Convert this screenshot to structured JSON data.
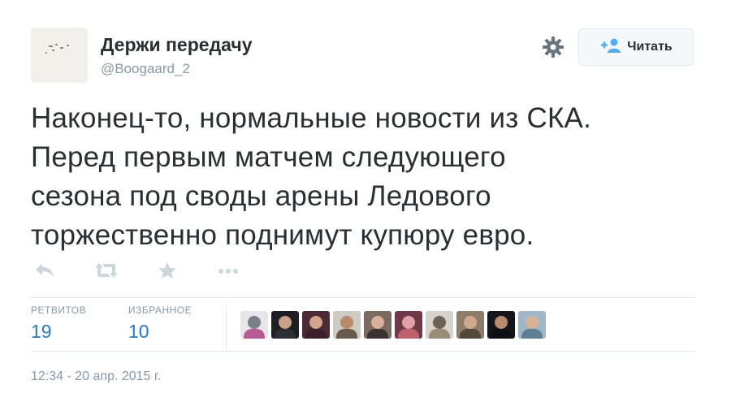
{
  "user": {
    "display_name": "Держи передачу",
    "handle": "@Boogaard_2"
  },
  "follow_button": {
    "label": "Читать",
    "icon": "follow-user-plus-icon"
  },
  "tweet": {
    "lines": [
      "Наконец-то, нормальные новости из СКА.",
      "Перед первым матчем следующего",
      "сезона под своды арены Ледового",
      "торжественно поднимут купюру евро."
    ]
  },
  "actions": [
    "reply-icon",
    "retweet-icon",
    "favorite-icon",
    "more-icon"
  ],
  "stats": {
    "retweets_label": "РЕТВИТОВ",
    "retweets_value": "19",
    "favorites_label": "ИЗБРАННОЕ",
    "favorites_value": "10"
  },
  "timestamp": "12:34 - 20 апр. 2015 г.",
  "colors": {
    "link_blue": "#2b7bb9",
    "muted_gray": "#8899a6",
    "text_dark": "#292f33",
    "icon_gray": "#ccd6dd"
  }
}
